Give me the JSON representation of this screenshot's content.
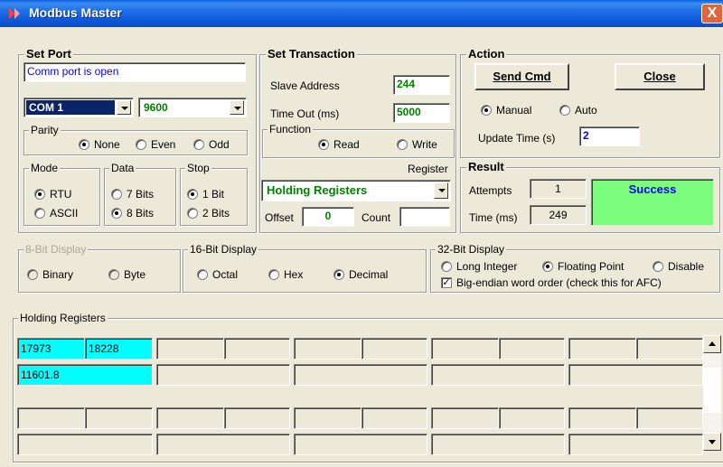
{
  "window": {
    "title": "Modbus Master",
    "close_glyph": "X"
  },
  "set_port": {
    "title": "Set Port",
    "status": "Comm port is open",
    "port": "COM 1",
    "baud": "9600",
    "parity": {
      "title": "Parity",
      "options": [
        "None",
        "Even",
        "Odd"
      ],
      "selected": "None"
    },
    "mode": {
      "title": "Mode",
      "options": [
        "RTU",
        "ASCII"
      ],
      "selected": "RTU"
    },
    "data": {
      "title": "Data",
      "options": [
        "7 Bits",
        "8 Bits"
      ],
      "selected": "8 Bits"
    },
    "stop": {
      "title": "Stop",
      "options": [
        "1 Bit",
        "2 Bits"
      ],
      "selected": "1 Bit"
    }
  },
  "set_transaction": {
    "title": "Set Transaction",
    "slave_address_label": "Slave Address",
    "slave_address": "244",
    "timeout_label": "Time Out (ms)",
    "timeout": "5000",
    "function": {
      "title": "Function",
      "options": [
        "Read",
        "Write"
      ],
      "selected": "Read"
    },
    "register_label": "Register",
    "register": "Holding Registers",
    "offset_label": "Offset",
    "offset": "0",
    "count_label": "Count",
    "count": ""
  },
  "action": {
    "title": "Action",
    "send_cmd": "Send Cmd",
    "close": "Close",
    "modes": [
      "Manual",
      "Auto"
    ],
    "selected_mode": "Manual",
    "update_time_label": "Update Time (s)",
    "update_time": "2"
  },
  "result": {
    "title": "Result",
    "attempts_label": "Attempts",
    "attempts": "1",
    "time_label": "Time (ms)",
    "time": "249",
    "status": "Success",
    "status_color": "#7cfc7c"
  },
  "display8": {
    "title": "8-Bit Display",
    "options": [
      "Binary",
      "Byte"
    ],
    "disabled": true
  },
  "display16": {
    "title": "16-Bit Display",
    "options": [
      "Octal",
      "Hex",
      "Decimal"
    ],
    "selected": "Decimal"
  },
  "display32": {
    "title": "32-Bit Display",
    "options": [
      "Long Integer",
      "Floating Point",
      "Disable"
    ],
    "selected": "Floating Point",
    "big_endian_label": "Big-endian word order (check this for AFC)",
    "big_endian_checked": true
  },
  "registers": {
    "title": "Holding Registers",
    "row1": [
      "17973",
      "18228",
      "",
      "",
      "",
      "",
      "",
      "",
      "",
      ""
    ],
    "row2": [
      "11601.8",
      "",
      "",
      "",
      ""
    ],
    "row3": [
      "",
      "",
      "",
      "",
      "",
      "",
      "",
      "",
      "",
      ""
    ],
    "row4": [
      "",
      "",
      "",
      "",
      ""
    ],
    "highlight_color": "#00ffff"
  }
}
